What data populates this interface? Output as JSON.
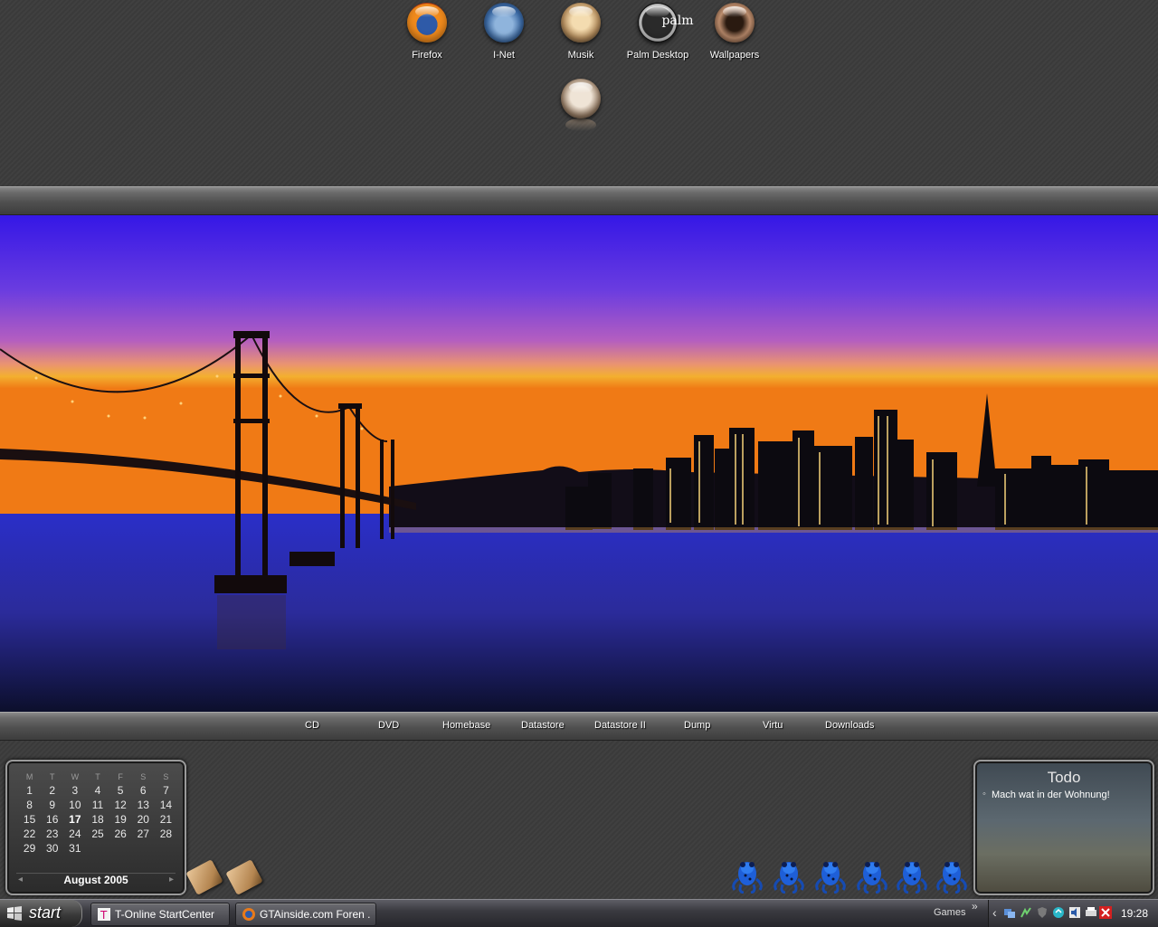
{
  "desktop": {
    "icons": [
      {
        "label": "Firefox",
        "icon": "firefox-icon"
      },
      {
        "label": "I-Net",
        "icon": "globe-icon"
      },
      {
        "label": "Musik",
        "icon": "music-icon"
      },
      {
        "label": "Palm Desktop",
        "icon": "palm-icon",
        "logo_text": "palm"
      },
      {
        "label": "Wallpapers",
        "icon": "wallpapers-icon"
      },
      {
        "label": "",
        "icon": "extra-icon"
      }
    ]
  },
  "drives": [
    "CD",
    "DVD",
    "Homebase",
    "Datastore",
    "Datastore II",
    "Dump",
    "Virtu",
    "Downloads"
  ],
  "calendar": {
    "weekdays": [
      "M",
      "T",
      "W",
      "T",
      "F",
      "S",
      "S"
    ],
    "weeks": [
      [
        "1",
        "2",
        "3",
        "4",
        "5",
        "6",
        "7"
      ],
      [
        "8",
        "9",
        "10",
        "11",
        "12",
        "13",
        "14"
      ],
      [
        "15",
        "16",
        "17",
        "18",
        "19",
        "20",
        "21"
      ],
      [
        "22",
        "23",
        "24",
        "25",
        "26",
        "27",
        "28"
      ],
      [
        "29",
        "30",
        "31",
        "",
        "",
        "",
        ""
      ]
    ],
    "today": "17",
    "month_label": "August 2005",
    "prev_symbol": "◂",
    "next_symbol": "▸"
  },
  "todo": {
    "title": "Todo",
    "items": [
      "Mach wat in der Wohnung!"
    ]
  },
  "frogs": {
    "count": 6,
    "icon": "frog-icon"
  },
  "taskbar": {
    "start_label": "start",
    "tasks": [
      {
        "label": "T-Online StartCenter",
        "icon": "t-online-icon"
      },
      {
        "label": "GTAinside.com Foren ...",
        "icon": "firefox-icon"
      }
    ],
    "toolbar_label": "Games",
    "toolbar_chevron": "»",
    "tray_chevron": "‹",
    "clock": "19:28"
  },
  "colors": {
    "desktop_bg": "#3c3c3c",
    "sky_top": "#3a1ee0",
    "sky_mid": "#9a4fd0",
    "sunset": "#f08020",
    "water": "#2a2fa0",
    "frog_blue": "#1e5fd8",
    "todo_red_icon": "#d42020"
  }
}
